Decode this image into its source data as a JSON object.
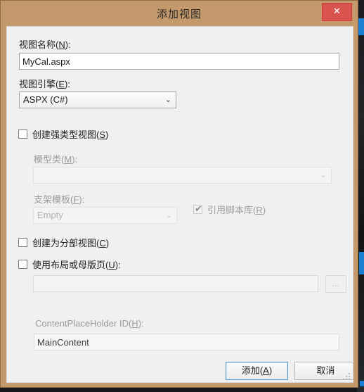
{
  "window": {
    "title": "添加视图",
    "close_label": "✕",
    "close_icon": "close-icon"
  },
  "form": {
    "view_name": {
      "label_prefix": "视图名称(",
      "label_key": "N",
      "label_suffix": "):",
      "value": "MyCal.aspx"
    },
    "view_engine": {
      "label_prefix": "视图引擎(",
      "label_key": "E",
      "label_suffix": "):",
      "value": "ASPX (C#)",
      "chevron": "⌄"
    },
    "strongly_typed": {
      "label_prefix": "创建强类型视图(",
      "label_key": "S",
      "label_suffix": ")",
      "checked": false
    },
    "model_class": {
      "label_prefix": "模型类(",
      "label_key": "M",
      "label_suffix": "):",
      "value": "",
      "chevron": "⌄",
      "disabled": true
    },
    "scaffold_template": {
      "label_prefix": "支架模板(",
      "label_key": "F",
      "label_suffix": "):",
      "value": "Empty",
      "chevron": "⌄",
      "disabled": true
    },
    "reference_script_libraries": {
      "label_prefix": "引用脚本库(",
      "label_key": "R",
      "label_suffix": ")",
      "checked": true,
      "check_glyph": "✔",
      "disabled": true
    },
    "create_as_partial": {
      "label_prefix": "创建为分部视图(",
      "label_key": "C",
      "label_suffix": ")",
      "checked": false
    },
    "use_layout": {
      "label_prefix": "使用布局或母版页(",
      "label_key": "U",
      "label_suffix": "):",
      "checked": false
    },
    "layout_path": {
      "value": "",
      "browse_label": "...",
      "disabled": true
    },
    "content_placeholder": {
      "label_prefix": "ContentPlaceHolder ID(",
      "label_key": "H",
      "label_suffix": "):",
      "value": "MainContent",
      "disabled": true
    }
  },
  "buttons": {
    "add_prefix": "添加(",
    "add_key": "A",
    "add_suffix": ")",
    "cancel": "取消"
  },
  "colors": {
    "titlebar": "#c49a6c",
    "close_button": "#d9534f",
    "dialog_bg": "#f0f0f0",
    "default_button_border": "#5c9ccc"
  }
}
